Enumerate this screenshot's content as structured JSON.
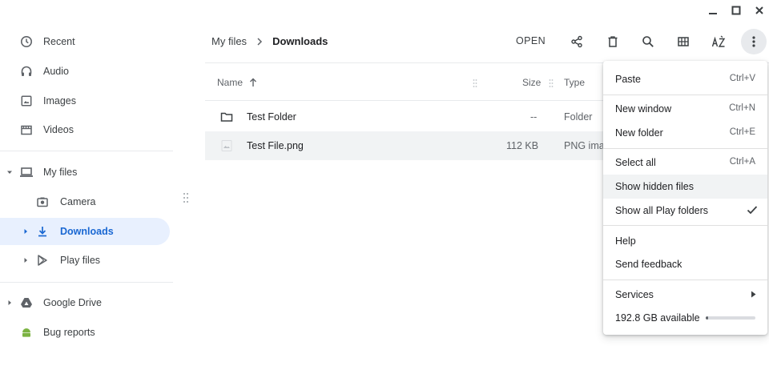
{
  "window": {
    "minimize": "minimize",
    "maximize": "maximize",
    "close": "close"
  },
  "sidebar": {
    "recent": "Recent",
    "audio": "Audio",
    "images": "Images",
    "videos": "Videos",
    "my_files": "My files",
    "camera": "Camera",
    "downloads": "Downloads",
    "play_files": "Play files",
    "google_drive": "Google Drive",
    "bug_reports": "Bug reports"
  },
  "breadcrumb": {
    "parent": "My files",
    "current": "Downloads"
  },
  "toolbar": {
    "open_label": "OPEN",
    "icons": [
      "share-icon",
      "delete-icon",
      "search-icon",
      "grid-view-icon",
      "sort-az-icon",
      "more-vert-icon"
    ]
  },
  "file_list": {
    "columns": {
      "name": "Name",
      "size": "Size",
      "type": "Type"
    },
    "rows": [
      {
        "name": "Test Folder",
        "size": "--",
        "type": "Folder",
        "icon": "folder-icon"
      },
      {
        "name": "Test File.png",
        "size": "112 KB",
        "type": "PNG ima",
        "icon": "image-file-icon"
      }
    ]
  },
  "menu": {
    "paste": {
      "label": "Paste",
      "shortcut": "Ctrl+V"
    },
    "new_window": {
      "label": "New window",
      "shortcut": "Ctrl+N"
    },
    "new_folder": {
      "label": "New folder",
      "shortcut": "Ctrl+E"
    },
    "select_all": {
      "label": "Select all",
      "shortcut": "Ctrl+A"
    },
    "show_hidden": {
      "label": "Show hidden files"
    },
    "show_play": {
      "label": "Show all Play folders",
      "checked": true
    },
    "help": {
      "label": "Help"
    },
    "feedback": {
      "label": "Send feedback"
    },
    "services": {
      "label": "Services"
    },
    "storage": {
      "label": "192.8 GB available",
      "used_fraction": 0.05
    }
  },
  "colors": {
    "accent": "#1967d2",
    "active_bg": "#e8f0fe",
    "icon": "#5f6368"
  }
}
